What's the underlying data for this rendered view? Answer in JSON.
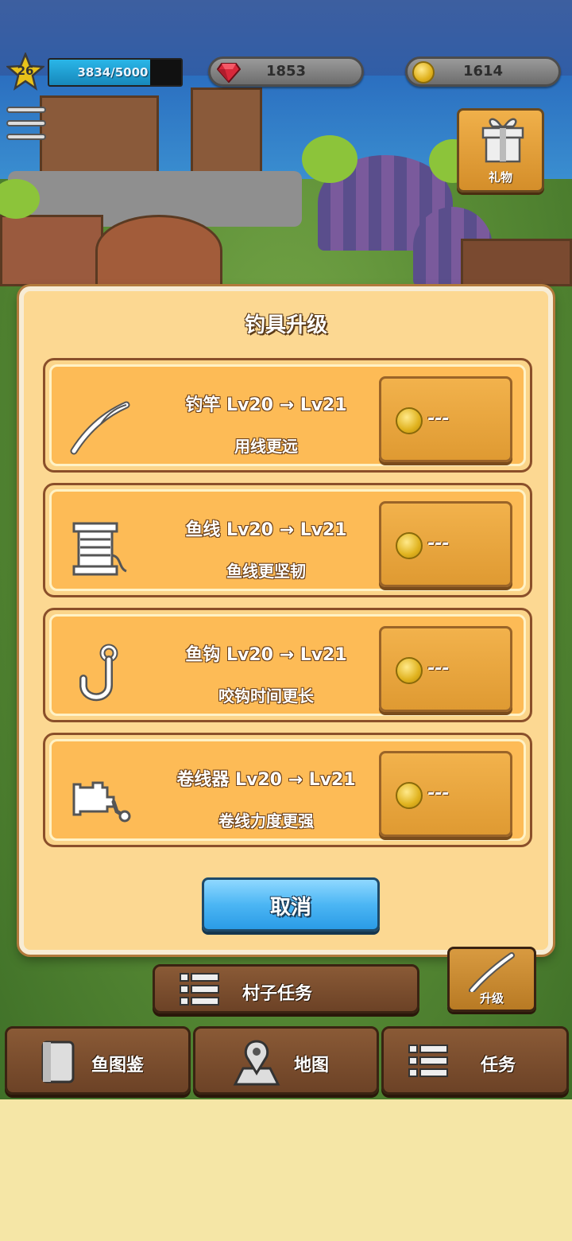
{
  "hud": {
    "level": "26",
    "xp_text": "3834/5000",
    "xp_fraction": 0.7668,
    "gems": "1853",
    "coins": "1614"
  },
  "gift": {
    "label": "礼物",
    "icon": "gift-icon"
  },
  "modal": {
    "title": "钓具升级",
    "items": [
      {
        "name": "钓竿 Lv20 → Lv21",
        "desc": "用线更远",
        "price": "---",
        "icon": "fishing-rod-icon"
      },
      {
        "name": "鱼线 Lv20 → Lv21",
        "desc": "鱼线更坚韧",
        "price": "---",
        "icon": "fishing-line-spool-icon"
      },
      {
        "name": "鱼钩 Lv20 → Lv21",
        "desc": "咬钩时间更长",
        "price": "---",
        "icon": "fish-hook-icon"
      },
      {
        "name": "卷线器 Lv20 → Lv21",
        "desc": "卷线力度更强",
        "price": "---",
        "icon": "reel-icon"
      }
    ],
    "cancel_label": "取消"
  },
  "bottom": {
    "village_tasks": "村子任务",
    "upgrade": "升级",
    "fish_book": "鱼图鉴",
    "map": "地图",
    "tasks": "任务"
  },
  "colors": {
    "panel": "#fcd892",
    "card": "#fdbb56",
    "cancel": "#4cb6f4",
    "wood": "#7a4c2c"
  }
}
